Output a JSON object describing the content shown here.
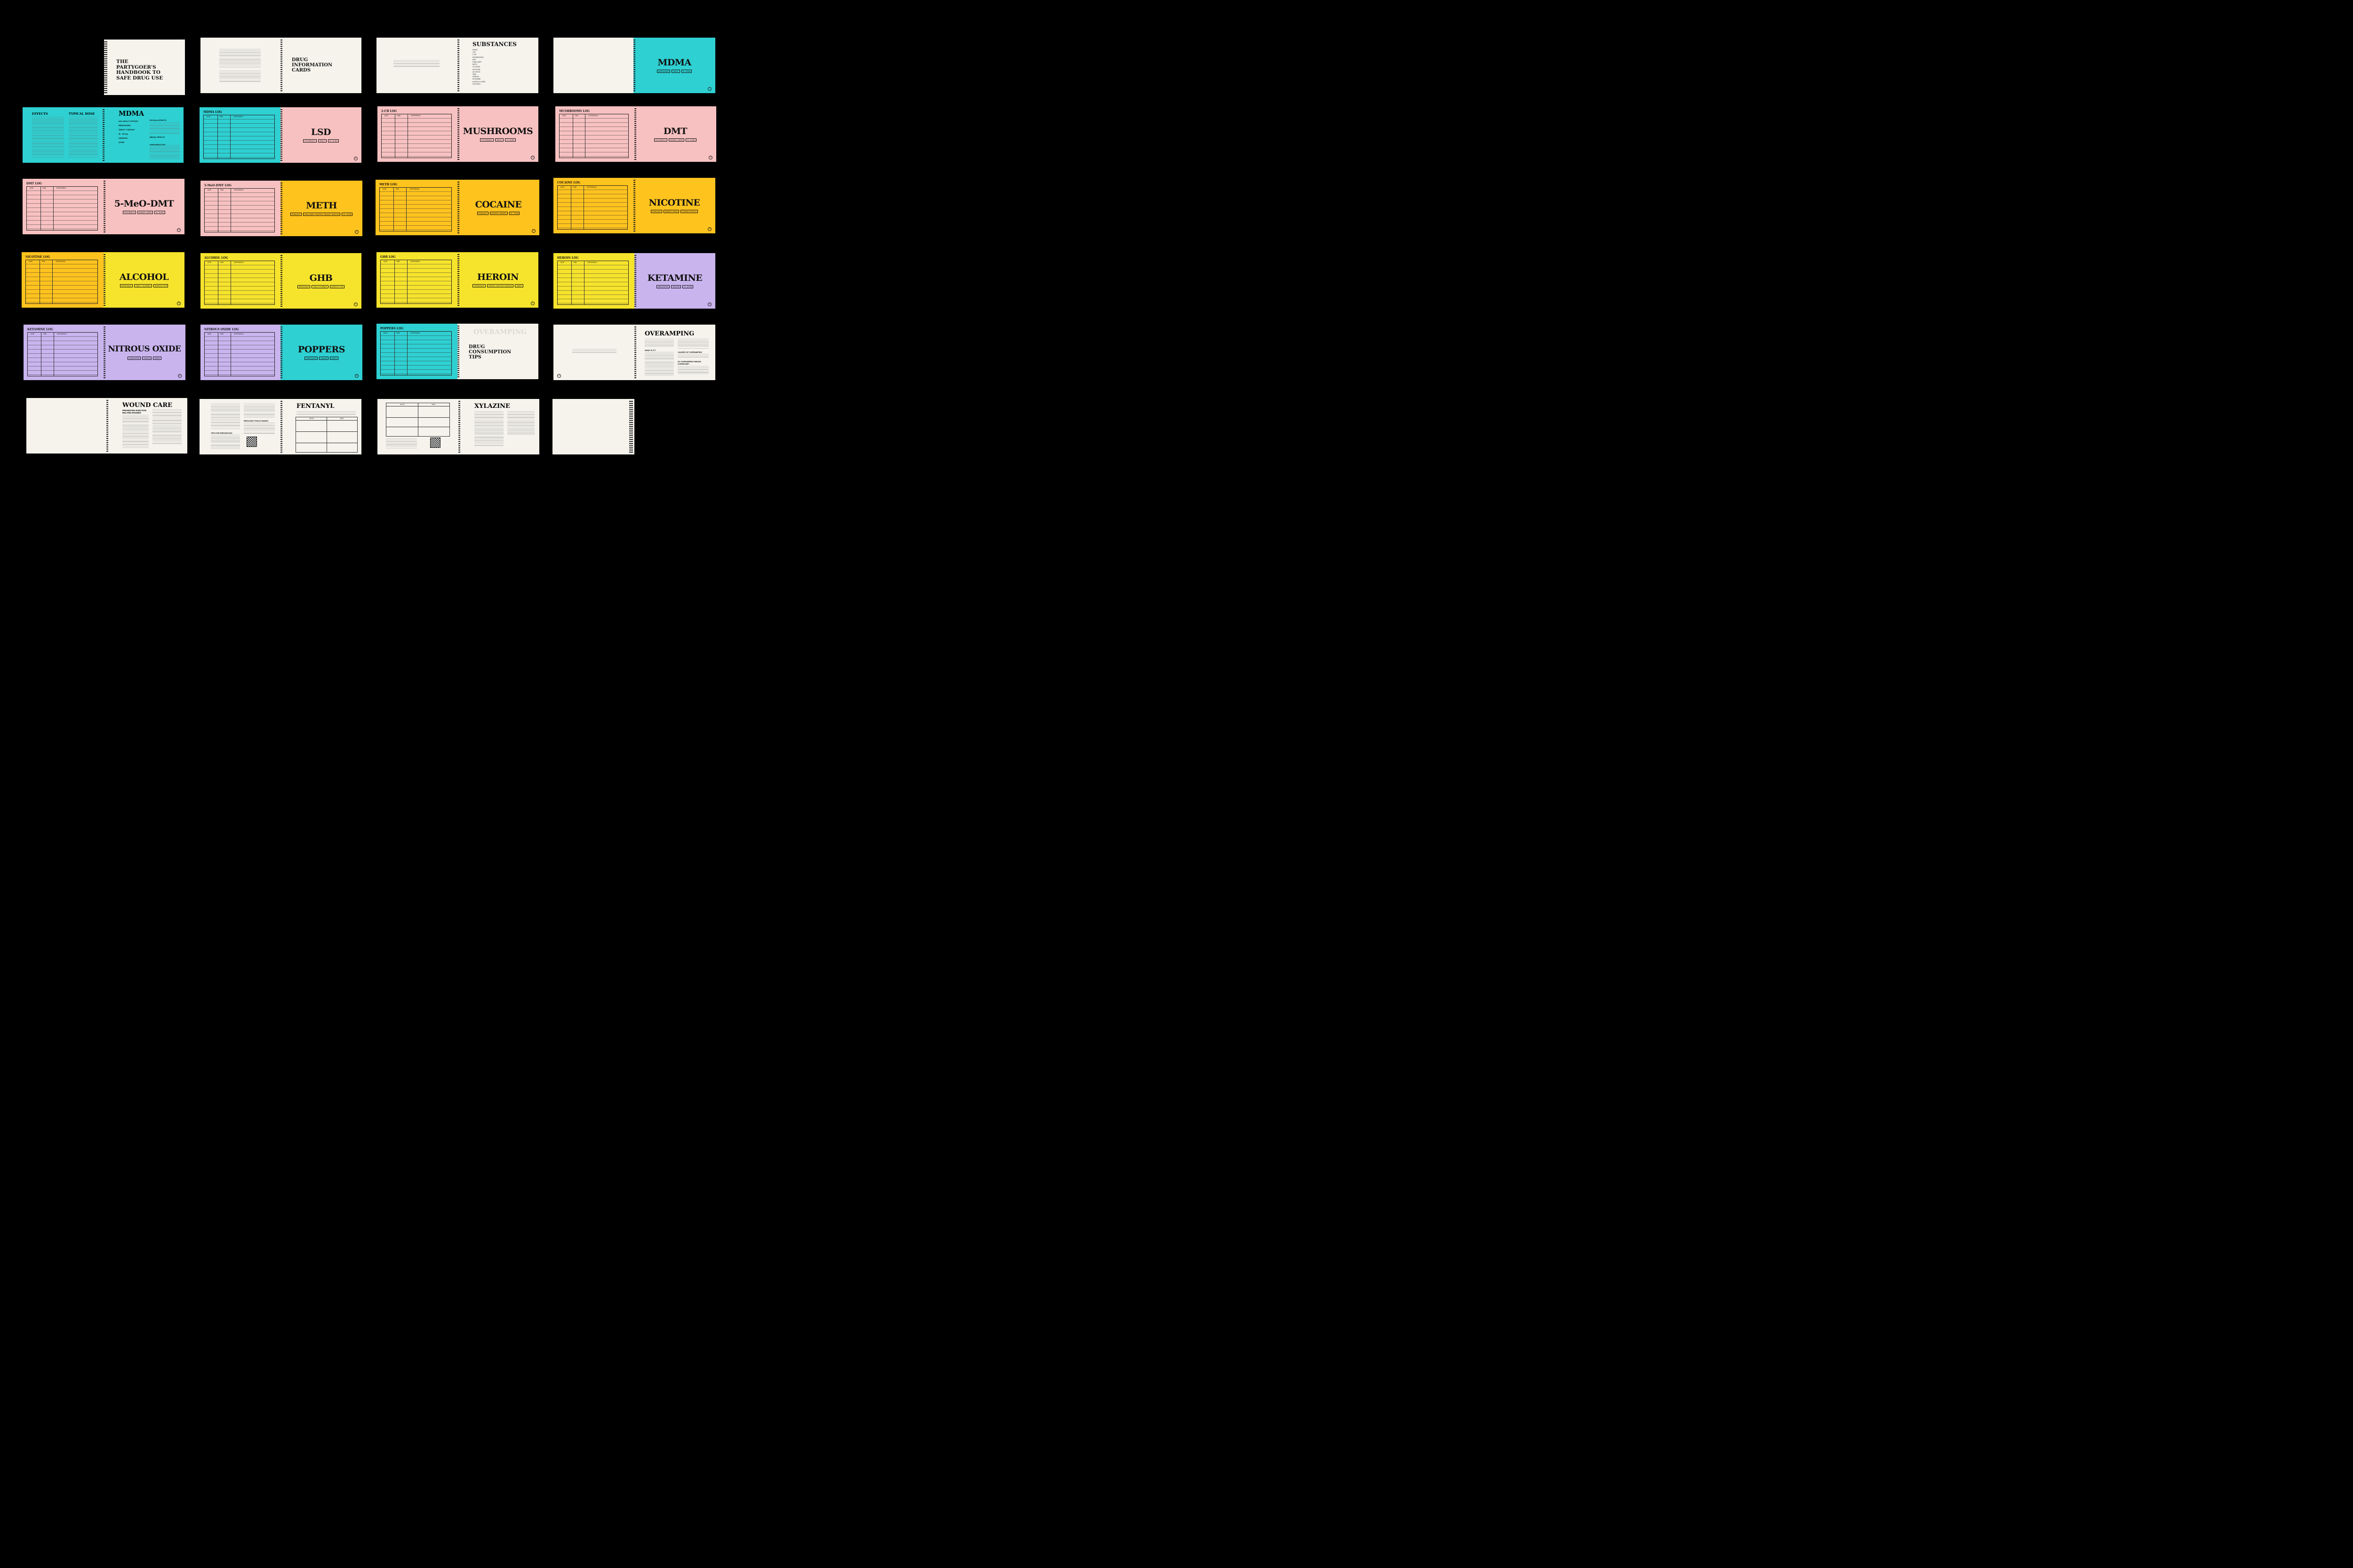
{
  "colors": {
    "cream": "#f5f3ec",
    "cyan": "#2fd0d2",
    "pink": "#f8c1c1",
    "orange": "#ffc31e",
    "yellow": "#f6e32c",
    "lavender": "#c9b4ee",
    "background": "#000000"
  },
  "row1": {
    "cover_title": [
      "THE",
      "PARTYGOER'S",
      "HANDBOOK TO",
      "SAFE DRUG USE"
    ],
    "info_title": [
      "DRUG",
      "INFORMATION",
      "CARDS"
    ],
    "substances_title": "SUBSTANCES",
    "substances_list": [
      "MDMA",
      "LSD",
      "2-CB",
      "MUSHROOMS",
      "DMT",
      "5-MeO-DMT",
      "METH",
      "COCAINE",
      "NICOTINE",
      "ALCOHOL",
      "GHB",
      "HEROIN",
      "KETAMINE",
      "NITROUS OXIDE",
      "POPPERS"
    ],
    "mdma_title": "MDMA",
    "mdma_tags": [
      "EMPATHOGEN",
      "TABLET",
      "30 - 45 MIN"
    ]
  },
  "row2": {
    "effects_head": "EFFECTS",
    "dose_head": "TYPICAL DOSE",
    "mdma_detail_title": "MDMA",
    "mdma_detail_labels": [
      "AKA: MOLLY / ECSTASY",
      "EMPATHOGEN",
      "TABLET / CAPSULE",
      "80 - 120 mg",
      "DURATION",
      "AFTER",
      "PHYSICAL EFFECTS",
      "MENTAL EFFECTS",
      "HARM REDUCTION"
    ],
    "mdma_log": "MDMA LOG",
    "lsd_title": "LSD",
    "lsd_tags": [
      "PSYCHEDELIC",
      "ORALLY",
      "60 - 90 MIN"
    ],
    "twocb_log": "2-CB LOG",
    "mush_title": "MUSHROOMS",
    "mush_tags": [
      "PSYCHEDELIC",
      "ORALLY",
      "15 - 45 MIN"
    ],
    "mush_log": "MUSHROOMS LOG",
    "dmt_title": "DMT",
    "dmt_tags": [
      "PSYCHEDELIC",
      "SMOKED / VAPED",
      "10 - 15 SEC"
    ]
  },
  "row3": {
    "dmt_log": "DMT LOG",
    "five_title": "5-MeO-DMT",
    "five_tags": [
      "PSYCHEDELIC",
      "SMOKED / VAPED",
      "15 - 30 SEC"
    ],
    "five_log": "5-MeO-DMT LOG",
    "meth_title": "METH",
    "meth_tags": [
      "STIMULANT",
      "SWALLOWED / SNORTED / SMOKED / INJECTED",
      "15 - 45 MIN"
    ],
    "meth_log": "METH LOG",
    "cocaine_title": "COCAINE",
    "cocaine_tags": [
      "STIMULANT",
      "SNORTED / SMOKED",
      "15 - 70 MIN"
    ],
    "cocaine_log": "COCAINE LOG",
    "nicotine_title": "NICOTINE",
    "nicotine_tags": [
      "STIMULANT",
      "SMOKED / VAPED",
      "CHEWED OR PATCH"
    ]
  },
  "row4": {
    "nicotine_log": "NICOTINE LOG",
    "alcohol_title": "ALCOHOL",
    "alcohol_tags": [
      "DEPRESSANT",
      "ORALLY / SLURRING",
      "VARIES BY TYPE"
    ],
    "alcohol_log": "ALCOHOL LOG",
    "ghb_title": "GHB",
    "ghb_tags": [
      "DEPRESSANT",
      "ORALLY IN DRINKS",
      "VARIES BY TYPE"
    ],
    "ghb_log": "GHB LOG",
    "heroin_title": "HEROIN",
    "heroin_tags": [
      "DEPRESSANT",
      "SMOKED / INJECTED / SNORTED",
      "VARIES"
    ],
    "heroin_log": "HEROIN LOG",
    "ketamine_title": "KETAMINE",
    "ketamine_tags": [
      "DISSOCIATIVE",
      "SNORTED",
      "10 - 60 MIN"
    ]
  },
  "row5": {
    "ketamine_log": "KETAMINE LOG",
    "nitrous_title": "NITROUS OXIDE",
    "nitrous_tags": [
      "DISSOCIATIVE",
      "INHALED",
      "VARIES"
    ],
    "nitrous_log": "NITROUS OXIDE LOG",
    "poppers_title": "POPPERS",
    "poppers_tags": [
      "DISSOCIATIVE",
      "INHALED",
      "VARIES"
    ],
    "poppers_log": "POPPERS LOG",
    "tips_ghost": "OVERAMPING",
    "tips_title": [
      "DRUG",
      "CONSUMPTION",
      "TIPS"
    ],
    "overamping_title": "OVERAMPING",
    "overamping_heads": [
      "WHAT IS IT?",
      "CAUSES OF OVERAMPING",
      "SO OVERAMPING MEANS OVERDOSE?"
    ]
  },
  "row6": {
    "wound_title": "WOUND CARE",
    "wound_sub": [
      "PREVENTING INJECTION",
      "RELATED WOUNDS"
    ],
    "fent_heads": [
      "REDUCING TRACK MARKS",
      "TIPS FOR PREVENTION"
    ],
    "fentanyl_title": "FENTANYL",
    "xylazine_title": "XYLAZINE",
    "myth_head": "MYTH",
    "fact_head": "FACT"
  },
  "log_columns": [
    "DATE",
    "TIME",
    "EXPERIENCE"
  ]
}
